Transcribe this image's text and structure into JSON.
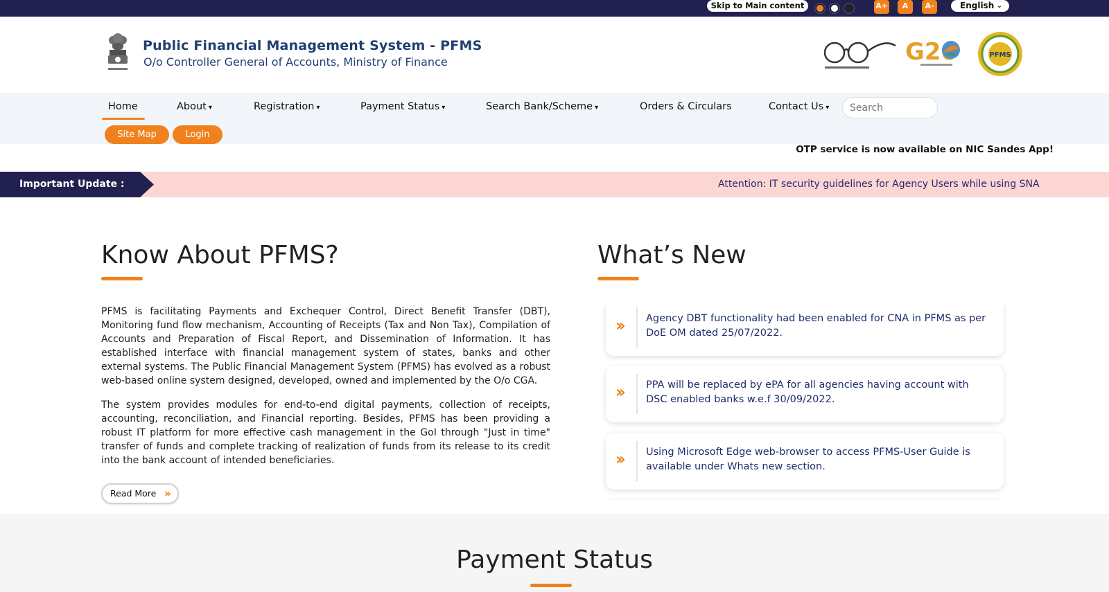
{
  "topbar": {
    "skip_label": "Skip to Main content",
    "font_increase": "A+",
    "font_normal": "A",
    "font_decrease": "A-",
    "language": "English"
  },
  "header": {
    "title": "Public Financial Management System - PFMS",
    "subtitle": "O/o Controller General of Accounts, Ministry of Finance",
    "seal_text": "PFMS",
    "g20_text": "G20"
  },
  "nav": {
    "items": [
      {
        "label": "Home"
      },
      {
        "label": "About"
      },
      {
        "label": "Registration"
      },
      {
        "label": "Payment Status"
      },
      {
        "label": "Search Bank/Scheme"
      },
      {
        "label": "Orders & Circulars"
      },
      {
        "label": "Contact Us"
      }
    ],
    "caret": "▾",
    "search_placeholder": "Search",
    "site_map": "Site Map",
    "login": "Login"
  },
  "marquee": {
    "otp": "OTP service is now available on NIC Sandes App!"
  },
  "update": {
    "label": "Important Update :",
    "message": "Attention: IT security guidelines for Agency Users while using SNA"
  },
  "know": {
    "title": "Know About PFMS?",
    "para1": "PFMS is facilitating Payments and Exchequer Control, Direct Benefit Transfer (DBT), Monitoring fund flow mechanism, Accounting of Receipts (Tax and Non Tax), Compilation of Accounts and Preparation of Fiscal Report, and Dissemination of Information. It has established interface with financial management system of states, banks and other external systems. The Public Financial Management System (PFMS) has evolved as a robust web-based online system designed, developed, owned and implemented by the O/o CGA.",
    "para2": "The system provides modules for end-to-end digital payments, collection of receipts, accounting, reconciliation, and Financial reporting. Besides, PFMS has been providing a robust IT platform for more effective cash management in the GoI through \"Just in time\" transfer of funds and complete tracking of realization of funds from its release to its credit into the bank account of intended beneficiaries.",
    "read_more": "Read More"
  },
  "whats_new": {
    "title": "What’s New",
    "items": [
      {
        "text": "Agency DBT functionality had been enabled for CNA in PFMS as per DoE OM dated 25/07/2022."
      },
      {
        "text": "PPA will be replaced by ePA for all agencies having account with DSC enabled banks w.e.f 30/09/2022."
      },
      {
        "text": "Using Microsoft Edge web-browser to access PFMS-User Guide is available under Whats new section."
      }
    ]
  },
  "payment_status": {
    "title": "Payment Status"
  },
  "colors": {
    "topbar": "#22204f",
    "accent": "#f0821e",
    "navy_text": "#1f3f72",
    "update_bg": "#fbd6d2",
    "update_label_bg": "#22204f"
  },
  "icons": {
    "theme_dots": [
      "theme-orange-icon",
      "theme-white-icon",
      "theme-dark-icon"
    ],
    "news_bullet": "double-chevron-right-icon",
    "read_more_arrow": "double-chevron-right-icon"
  }
}
